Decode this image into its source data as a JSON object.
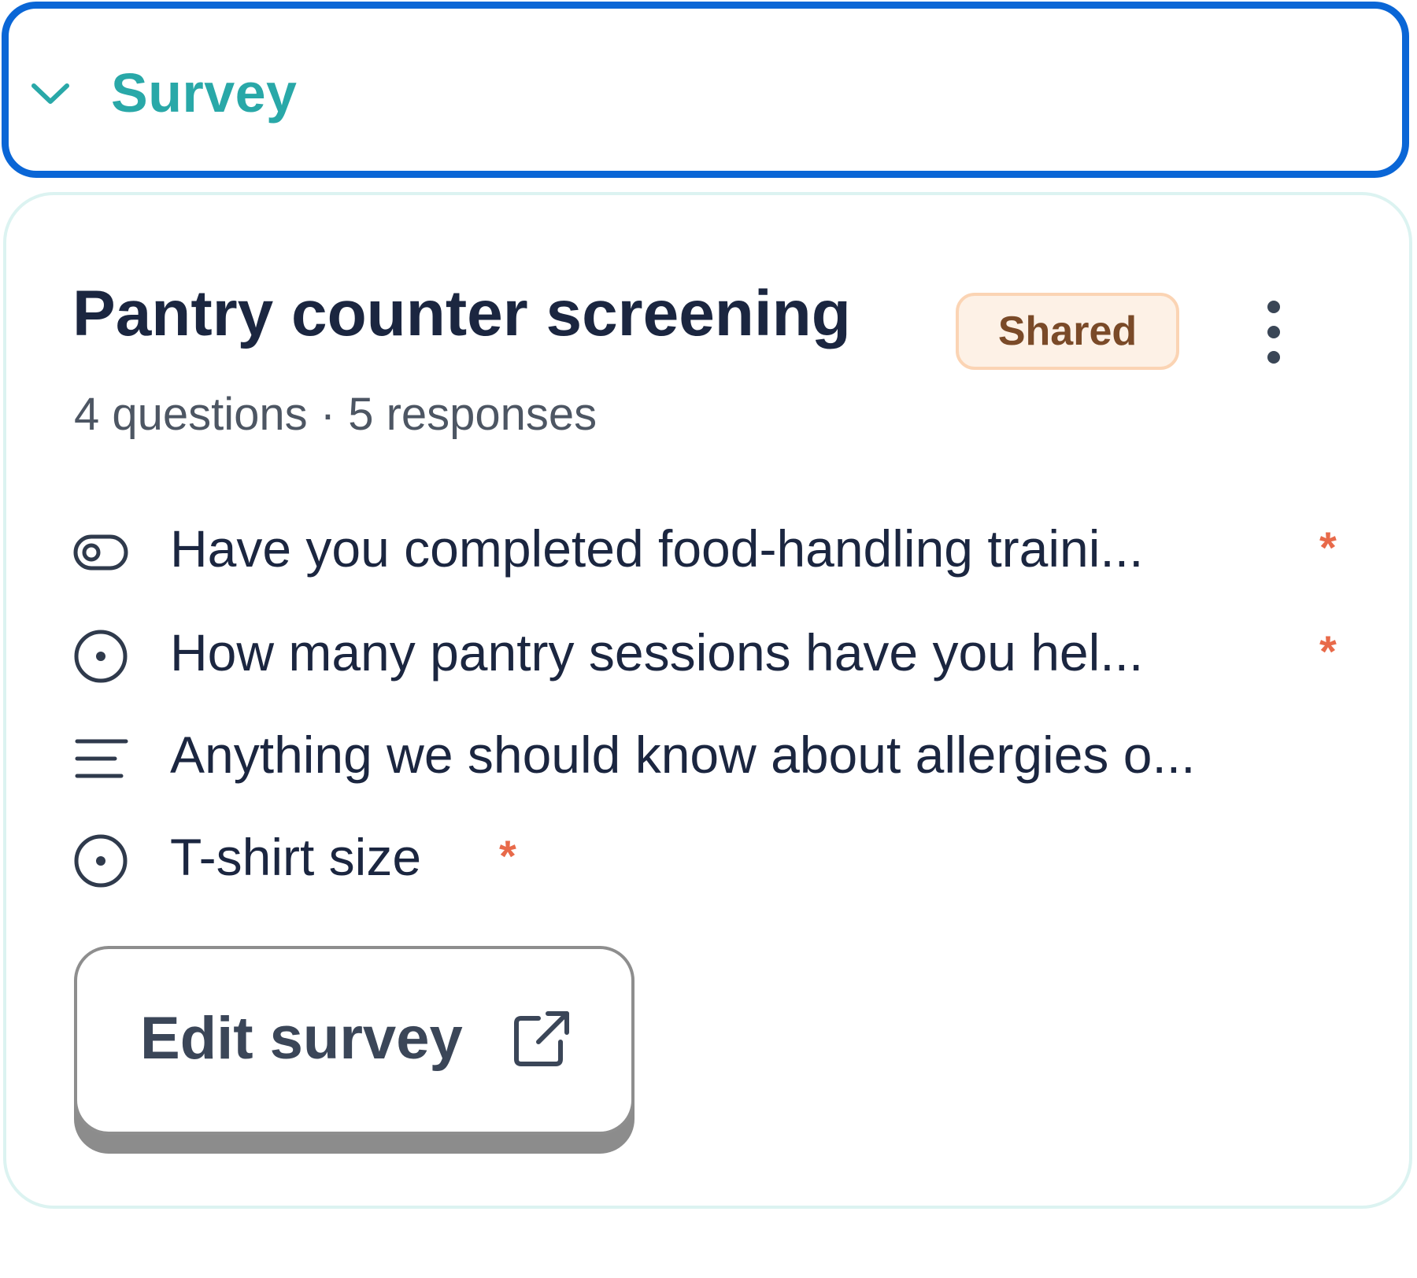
{
  "section": {
    "title": "Survey",
    "chevron_icon": "chevron-down-icon",
    "accent": "#29a8a8",
    "focus_border": "#0a66d6"
  },
  "survey": {
    "title": "Pantry counter screening",
    "badge": "Shared",
    "meta": "4 questions · 5 responses",
    "questions": [
      {
        "icon": "toggle-icon",
        "text": "Have you completed food-handling traini...",
        "required": "*"
      },
      {
        "icon": "radio-icon",
        "text": "How many pantry sessions have you hel...",
        "required": "*"
      },
      {
        "icon": "text-lines-icon",
        "text": "Anything we should know about allergies o...",
        "required": ""
      },
      {
        "icon": "radio-icon",
        "text": "T-shirt size",
        "required": "*"
      }
    ],
    "edit_button": "Edit survey",
    "edit_button_icon": "external-link-icon"
  }
}
